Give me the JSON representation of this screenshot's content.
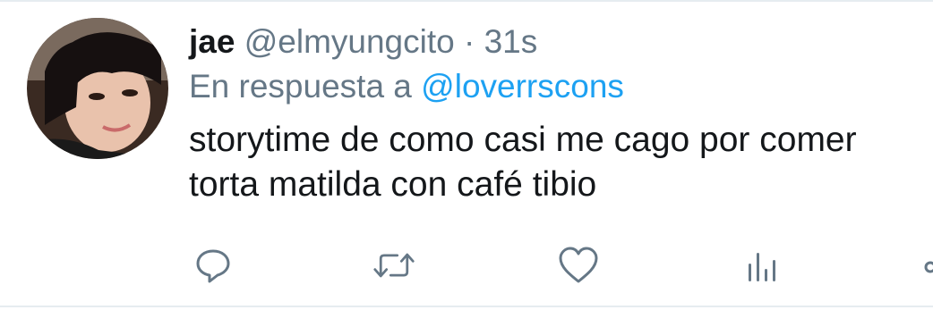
{
  "tweet": {
    "display_name": "jae",
    "handle": "@elmyungcito",
    "separator": "·",
    "timestamp": "31s",
    "reply_prefix": "En respuesta a",
    "reply_to": "@loverrscons",
    "text_lines": [
      "storytime de como casi me cago por comer",
      "torta matilda con café tibio"
    ]
  },
  "actions": {
    "reply_icon": "reply-icon",
    "retweet_icon": "retweet-icon",
    "like_icon": "heart-icon",
    "analytics_icon": "analytics-icon",
    "share_icon": "share-icon"
  },
  "colors": {
    "text_primary": "#14171a",
    "text_secondary": "#657786",
    "link": "#1da1f2",
    "icon": "#657786",
    "divider": "#e6ecf0"
  }
}
